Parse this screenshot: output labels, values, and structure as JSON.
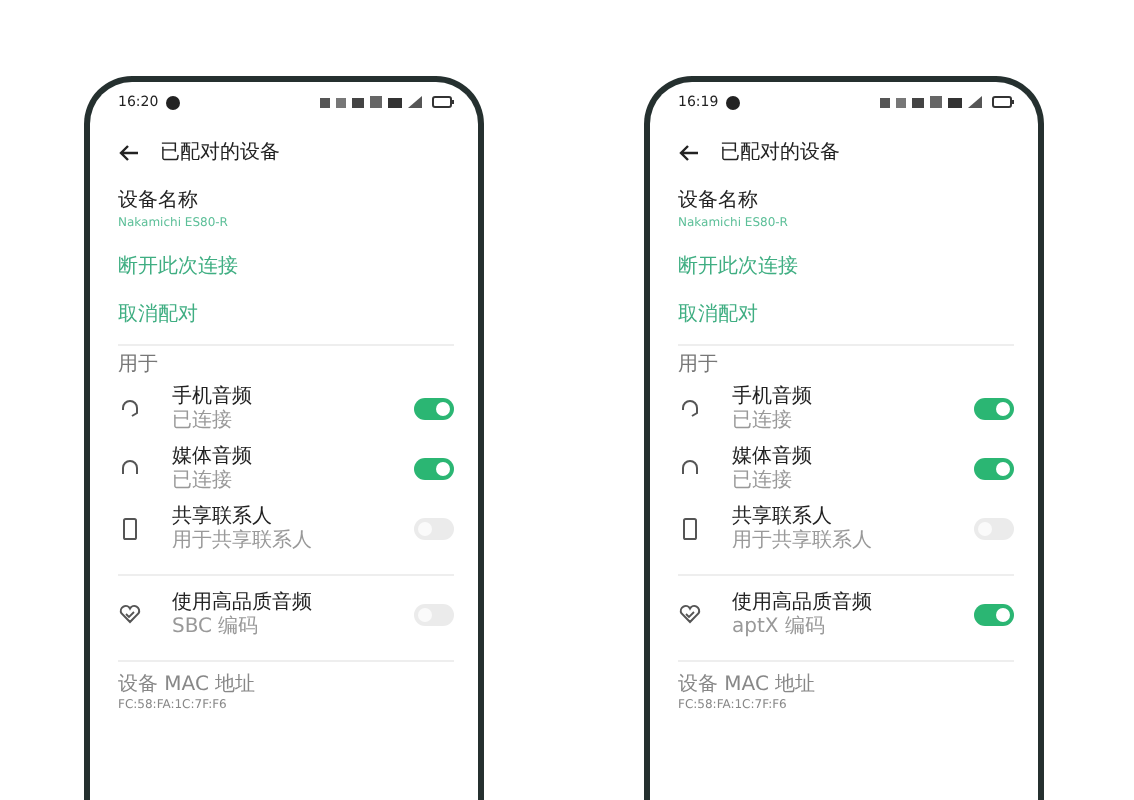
{
  "phones": [
    {
      "status_bar": {
        "time": "16:20"
      },
      "header": {
        "title": "已配对的设备"
      },
      "device_name": {
        "label": "设备名称",
        "value": "Nakamichi ES80-R"
      },
      "actions": [
        "断开此次连接",
        "取消配对"
      ],
      "section_label": "用于",
      "profiles": [
        {
          "title": "手机音频",
          "subtitle": "已连接",
          "kind": "headset",
          "on": true
        },
        {
          "title": "媒体音频",
          "subtitle": "已连接",
          "kind": "headphones",
          "on": true
        },
        {
          "title": "共享联系人",
          "subtitle": "用于共享联系人",
          "kind": "phone",
          "on": false
        }
      ],
      "hq_audio": {
        "title": "使用高品质音频",
        "subtitle": "SBC 编码",
        "on": false
      },
      "mac": {
        "label": "设备 MAC 地址",
        "value": "FC:58:FA:1C:7F:F6"
      }
    },
    {
      "status_bar": {
        "time": "16:19"
      },
      "header": {
        "title": "已配对的设备"
      },
      "device_name": {
        "label": "设备名称",
        "value": "Nakamichi ES80-R"
      },
      "actions": [
        "断开此次连接",
        "取消配对"
      ],
      "section_label": "用于",
      "profiles": [
        {
          "title": "手机音频",
          "subtitle": "已连接",
          "kind": "headset",
          "on": true
        },
        {
          "title": "媒体音频",
          "subtitle": "已连接",
          "kind": "headphones",
          "on": true
        },
        {
          "title": "共享联系人",
          "subtitle": "用于共享联系人",
          "kind": "phone",
          "on": false
        }
      ],
      "hq_audio": {
        "title": "使用高品质音频",
        "subtitle": "aptX 编码",
        "on": true
      },
      "mac": {
        "label": "设备 MAC 地址",
        "value": "FC:58:FA:1C:7F:F6"
      }
    }
  ]
}
